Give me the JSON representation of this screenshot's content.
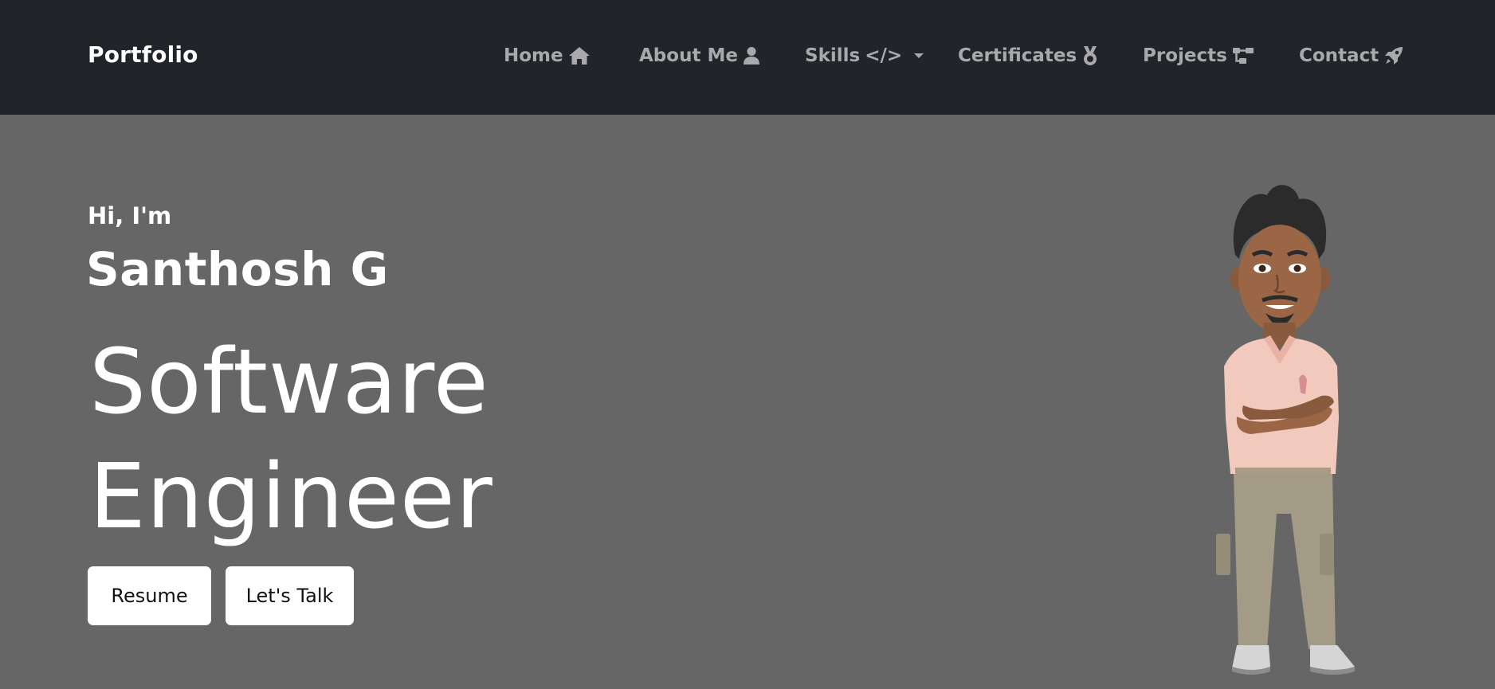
{
  "brand": "Portfolio",
  "nav": {
    "home": "Home",
    "about": "About Me",
    "skills": "Skills",
    "skills_glyph": "</>",
    "certificates": "Certificates",
    "projects": "Projects",
    "contact": "Contact"
  },
  "icons": {
    "home": "home-icon",
    "about": "user-icon",
    "skills": "chevron-down-icon",
    "certificates": "medal-icon",
    "projects": "diagram-icon",
    "contact": "rocket-icon"
  },
  "hero": {
    "greeting": "Hi, I'm",
    "name": "Santhosh G",
    "role_line1": "Software",
    "role_line2": "Engineer",
    "resume_label": "Resume",
    "talk_label": "Let's Talk"
  },
  "colors": {
    "navbar_bg": "#212529",
    "hero_bg": "#666666",
    "nav_text": "#a9a9ad",
    "text_light": "#ffffff",
    "button_bg": "#ffffff"
  }
}
